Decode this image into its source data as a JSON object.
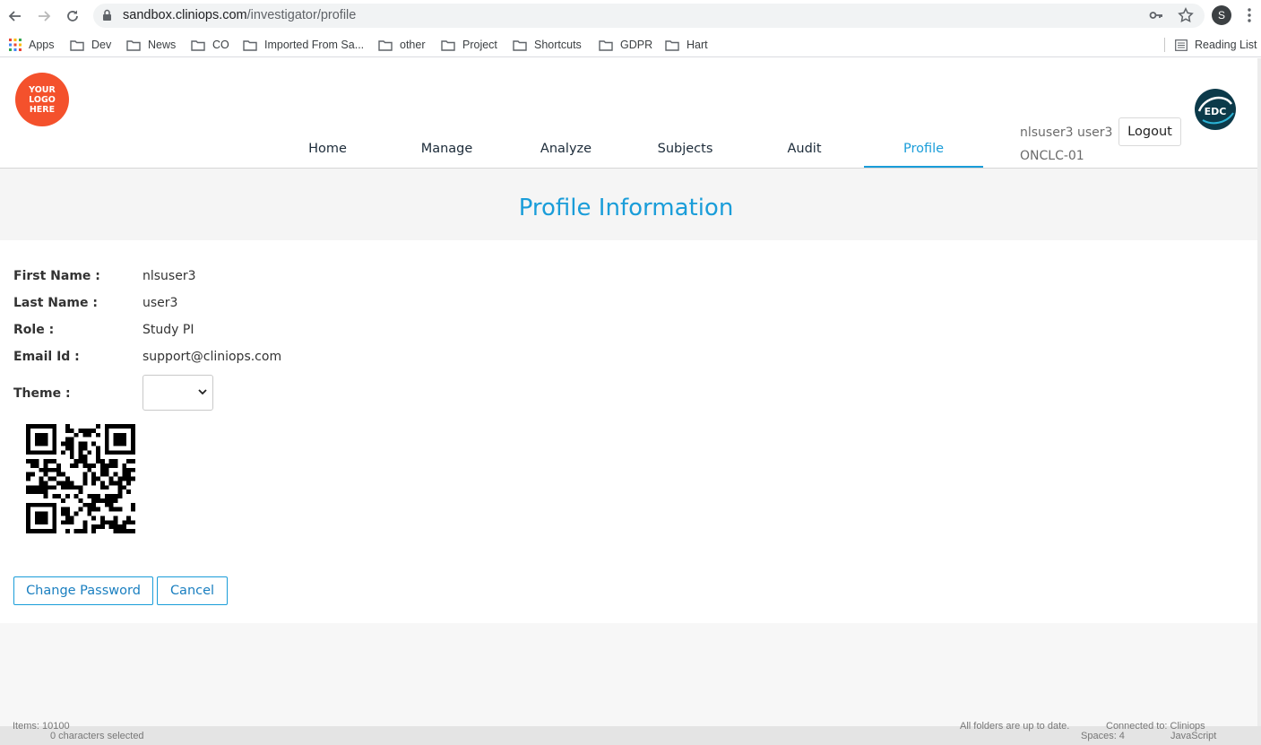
{
  "browser": {
    "url_host": "sandbox.cliniops.com",
    "url_path": "/investigator/profile",
    "profile_initial": "S",
    "bookmarks": [
      {
        "label": "Apps",
        "icon": "apps-grid-icon"
      },
      {
        "label": "Dev",
        "icon": "folder-icon"
      },
      {
        "label": "News",
        "icon": "folder-icon"
      },
      {
        "label": "CO",
        "icon": "folder-icon"
      },
      {
        "label": "Imported From Sa...",
        "icon": "folder-icon"
      },
      {
        "label": "other",
        "icon": "folder-icon"
      },
      {
        "label": "Project",
        "icon": "folder-icon"
      },
      {
        "label": "Shortcuts",
        "icon": "folder-icon"
      },
      {
        "label": "GDPR",
        "icon": "folder-icon"
      },
      {
        "label": "Hart",
        "icon": "folder-icon"
      }
    ],
    "reading_list": "Reading List"
  },
  "header": {
    "logo_lines": [
      "YOUR",
      "LOGO",
      "HERE"
    ],
    "logo_color": "#f4512c",
    "edc_logo_text": "EDC",
    "nav": [
      {
        "label": "Home",
        "active": false
      },
      {
        "label": "Manage",
        "active": false
      },
      {
        "label": "Analyze",
        "active": false
      },
      {
        "label": "Subjects",
        "active": false
      },
      {
        "label": "Audit",
        "active": false
      },
      {
        "label": "Profile",
        "active": true
      }
    ],
    "user_name": "nlsuser3 user3",
    "study_id": "ONCLC-01",
    "logout_label": "Logout",
    "accent_color": "#1a9dd9"
  },
  "profile": {
    "title": "Profile Information",
    "fields": [
      {
        "label": "First Name :",
        "value": "nlsuser3"
      },
      {
        "label": "Last Name :",
        "value": "user3"
      },
      {
        "label": "Role :",
        "value": "Study PI"
      },
      {
        "label": "Email Id :",
        "value": "support@cliniops.com"
      }
    ],
    "theme_label": "Theme :",
    "theme_selected": "",
    "change_password_label": "Change Password",
    "cancel_label": "Cancel"
  },
  "background_window": {
    "items_text": "Items: 10100",
    "selected_text": "0 characters selected",
    "folders_text": "All folders are up to date.",
    "connected_text": "Connected to: Cliniops",
    "spaces_text": "Spaces: 4",
    "lang_text": "JavaScript"
  }
}
